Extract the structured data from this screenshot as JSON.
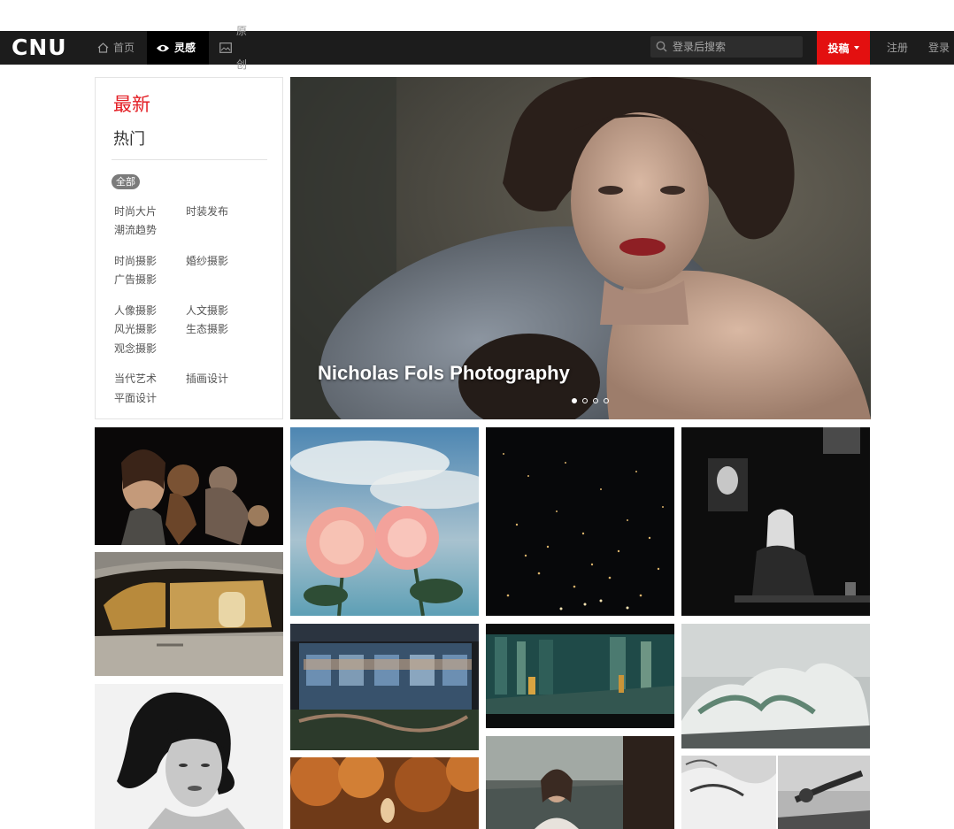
{
  "header": {
    "logo": "CNU",
    "nav": [
      {
        "label": "首页",
        "icon": "home-icon"
      },
      {
        "label": "灵感",
        "icon": "eye-icon"
      },
      {
        "label": "原创",
        "icon": "image-icon"
      }
    ],
    "search_placeholder": "登录后搜索",
    "submit_label": "投稿",
    "register_label": "注册",
    "login_label": "登录"
  },
  "sidebar": {
    "latest": "最新",
    "hot": "热门",
    "all_label": "全部",
    "categories": [
      "时尚大片",
      "时装发布",
      "潮流趋势",
      "时尚摄影",
      "婚纱摄影",
      "广告摄影",
      "人像摄影",
      "人文摄影",
      "风光摄影",
      "生态摄影",
      "观念摄影",
      "当代艺术",
      "插画设计",
      "平面设计"
    ]
  },
  "banner": {
    "title": "Nicholas Fols Photography",
    "slide_count": 4,
    "active_slide": 1
  },
  "colors": {
    "topbar": "#1c1c1c",
    "accent_red": "#e31010",
    "latest_red": "#e31e24"
  }
}
